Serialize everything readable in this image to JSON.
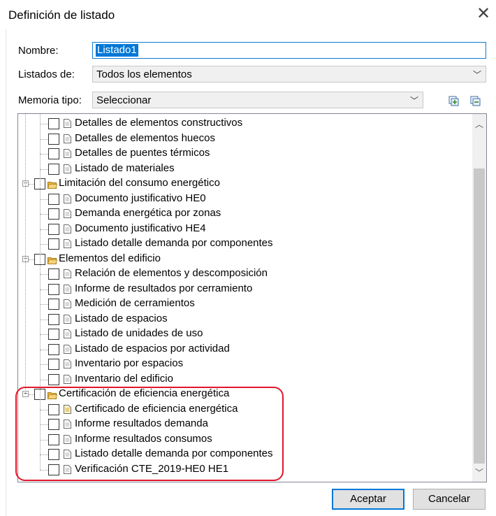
{
  "window": {
    "title": "Definición de listado"
  },
  "form": {
    "nombre_label": "Nombre:",
    "nombre_value": "Listado1",
    "listados_label": "Listados de:",
    "listados_value": "Todos los elementos",
    "memoria_label": "Memoria tipo:",
    "memoria_value": "Seleccionar"
  },
  "tree": [
    {
      "label": "Detalles de elementos constructivos",
      "kind": "doc"
    },
    {
      "label": "Detalles de elementos huecos",
      "kind": "doc"
    },
    {
      "label": "Detalles de puentes térmicos",
      "kind": "doc"
    },
    {
      "label": "Listado de materiales",
      "kind": "doc"
    },
    {
      "label": "Limitación del consumo energético",
      "kind": "folder"
    },
    {
      "label": "Documento justificativo HE0",
      "kind": "doc"
    },
    {
      "label": "Demanda energética por zonas",
      "kind": "doc"
    },
    {
      "label": "Documento justificativo HE4",
      "kind": "doc"
    },
    {
      "label": "Listado detalle demanda por componentes",
      "kind": "doc"
    },
    {
      "label": "Elementos del edificio",
      "kind": "folder"
    },
    {
      "label": "Relación de elementos y descomposición",
      "kind": "doc"
    },
    {
      "label": "Informe de resultados por cerramiento",
      "kind": "doc"
    },
    {
      "label": "Medición de cerramientos",
      "kind": "doc"
    },
    {
      "label": "Listado de espacios",
      "kind": "doc"
    },
    {
      "label": "Listado de unidades de uso",
      "kind": "doc"
    },
    {
      "label": "Listado de espacios por actividad",
      "kind": "doc"
    },
    {
      "label": "Inventario por espacios",
      "kind": "doc"
    },
    {
      "label": "Inventario del edificio",
      "kind": "doc"
    },
    {
      "label": "Certificación de eficiencia energética",
      "kind": "folder"
    },
    {
      "label": "Certificado de eficiencia energética",
      "kind": "doc-special"
    },
    {
      "label": "Informe resultados demanda",
      "kind": "doc"
    },
    {
      "label": "Informe resultados consumos",
      "kind": "doc"
    },
    {
      "label": "Listado detalle demanda por componentes",
      "kind": "doc"
    },
    {
      "label": "Verificación CTE_2019-HE0 HE1",
      "kind": "doc"
    }
  ],
  "buttons": {
    "ok": "Aceptar",
    "cancel": "Cancelar"
  },
  "colors": {
    "selection": "#0078d7",
    "highlight_outline": "#e1162b",
    "folder": "#e8b84a"
  }
}
